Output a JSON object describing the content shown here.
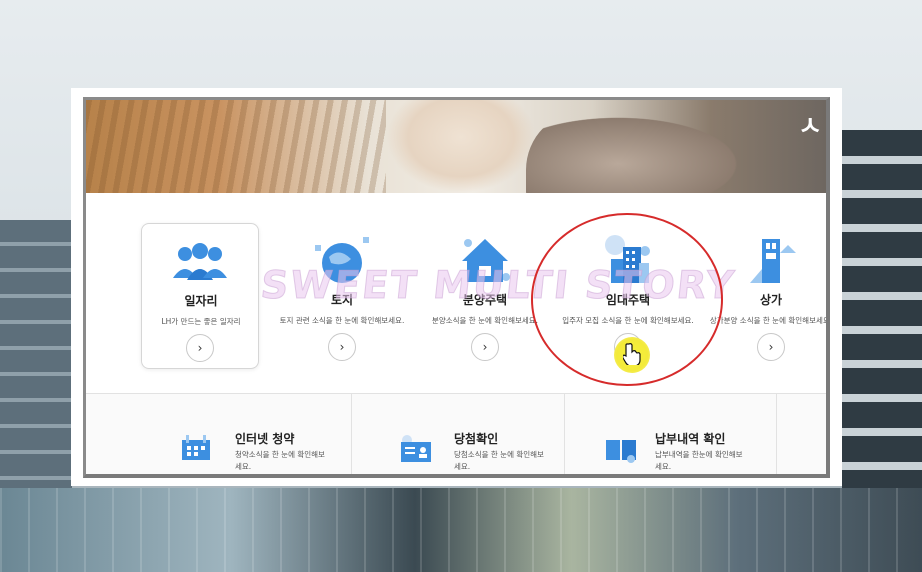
{
  "banner": {
    "title_glyph": "ㅅ"
  },
  "watermark": "SWEET MULTI STORY",
  "categories": [
    {
      "title": "일자리",
      "desc": "LH가 만드는 좋은 일자리",
      "go": "›",
      "icon": "people-icon"
    },
    {
      "title": "토지",
      "desc": "토지 관련 소식을 한 눈에 확인해보세요.",
      "go": "›",
      "icon": "land-globe-icon"
    },
    {
      "title": "분양주택",
      "desc": "분양소식을 한 눈에 확인해보세요.",
      "go": "›",
      "icon": "house-icon"
    },
    {
      "title": "임대주택",
      "desc": "입주자 모집 소식을 한 눈에 확인해보세요.",
      "go": "›",
      "icon": "apartment-icon"
    },
    {
      "title": "상가",
      "desc": "상가분양 소식을 한 눈에 확인해보세요.",
      "go": "›",
      "icon": "building-icon"
    }
  ],
  "services": [
    {
      "title": "인터넷 청약",
      "desc": "청약소식을 한 눈에 확인해보세요.",
      "icon": "calendar-building-icon"
    },
    {
      "title": "당첨확인",
      "desc": "당첨소식을 한 눈에 확인해보세요.",
      "icon": "id-card-icon"
    },
    {
      "title": "납부내역 확인",
      "desc": "납부내역을 한눈에 확인해보세요.",
      "icon": "book-icon"
    }
  ],
  "colors": {
    "accent_blue": "#3d8fe0",
    "light_blue": "#9cc8f1",
    "annotation_red": "#d62b2b",
    "cursor_yellow": "#f3ea3a"
  }
}
